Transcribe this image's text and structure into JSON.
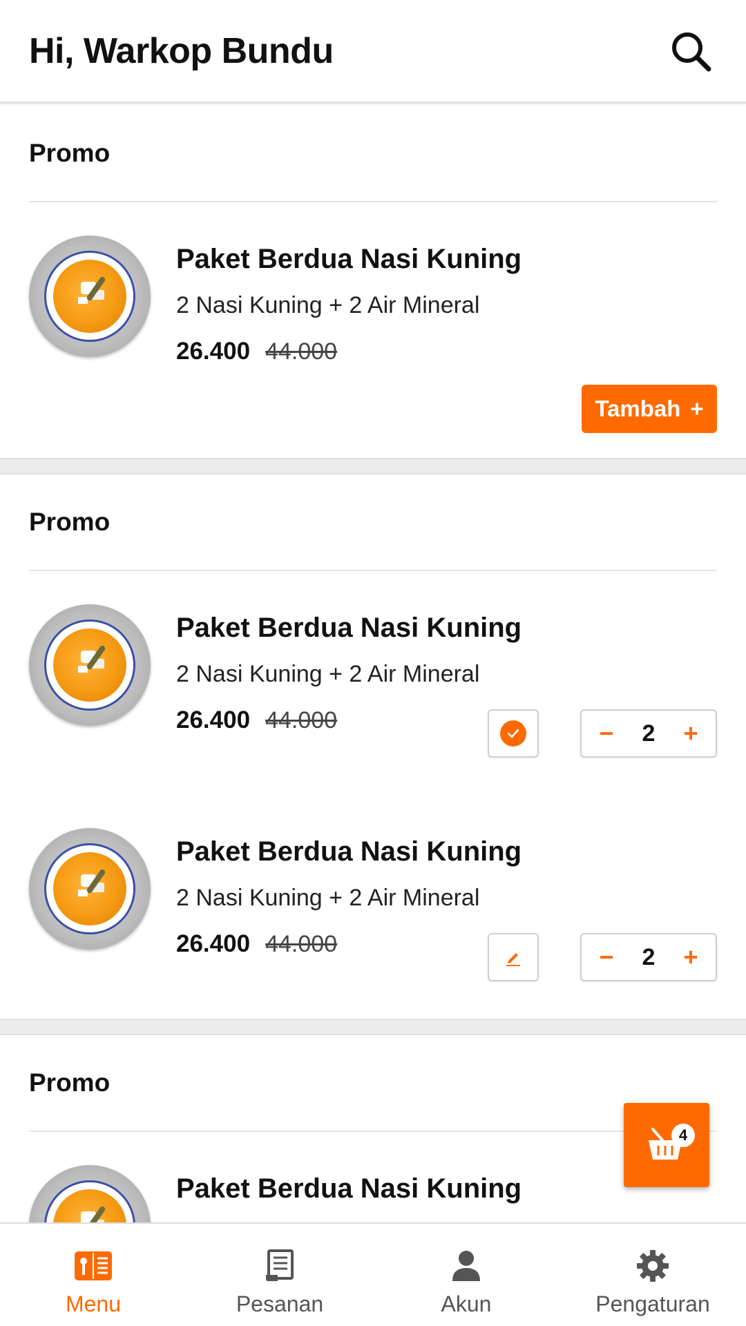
{
  "header": {
    "title": "Hi, Warkop Bundu",
    "search_icon": "search-icon"
  },
  "sections": [
    {
      "title": "Promo",
      "items": [
        {
          "name": "Paket Berdua Nasi Kuning",
          "desc": "2 Nasi Kuning + 2 Air Mineral",
          "price": "26.400",
          "old_price": "44.000",
          "button_label": "Tambah",
          "button_icon": "+"
        }
      ]
    },
    {
      "title": "Promo",
      "items": [
        {
          "name": "Paket Berdua Nasi Kuning",
          "desc": "2 Nasi Kuning + 2 Air Mineral",
          "price": "26.400",
          "old_price": "44.000",
          "note_icon": "check-icon",
          "qty": "2"
        },
        {
          "name": "Paket Berdua Nasi Kuning",
          "desc": "2 Nasi Kuning + 2 Air Mineral",
          "price": "26.400",
          "old_price": "44.000",
          "note_icon": "pencil-icon",
          "qty": "2"
        }
      ]
    },
    {
      "title": "Promo",
      "items": [
        {
          "name": "Paket Berdua Nasi Kuning"
        }
      ]
    }
  ],
  "stepper": {
    "minus": "−",
    "plus": "+"
  },
  "cart": {
    "icon": "basket-icon",
    "count": "4"
  },
  "bottom_nav": [
    {
      "label": "Menu",
      "icon": "menu-book-icon",
      "active": true
    },
    {
      "label": "Pesanan",
      "icon": "receipt-icon",
      "active": false
    },
    {
      "label": "Akun",
      "icon": "person-icon",
      "active": false
    },
    {
      "label": "Pengaturan",
      "icon": "gear-icon",
      "active": false
    }
  ],
  "colors": {
    "accent": "#ff6a00",
    "divider": "#ececec",
    "text": "#111111",
    "muted": "#555555"
  }
}
